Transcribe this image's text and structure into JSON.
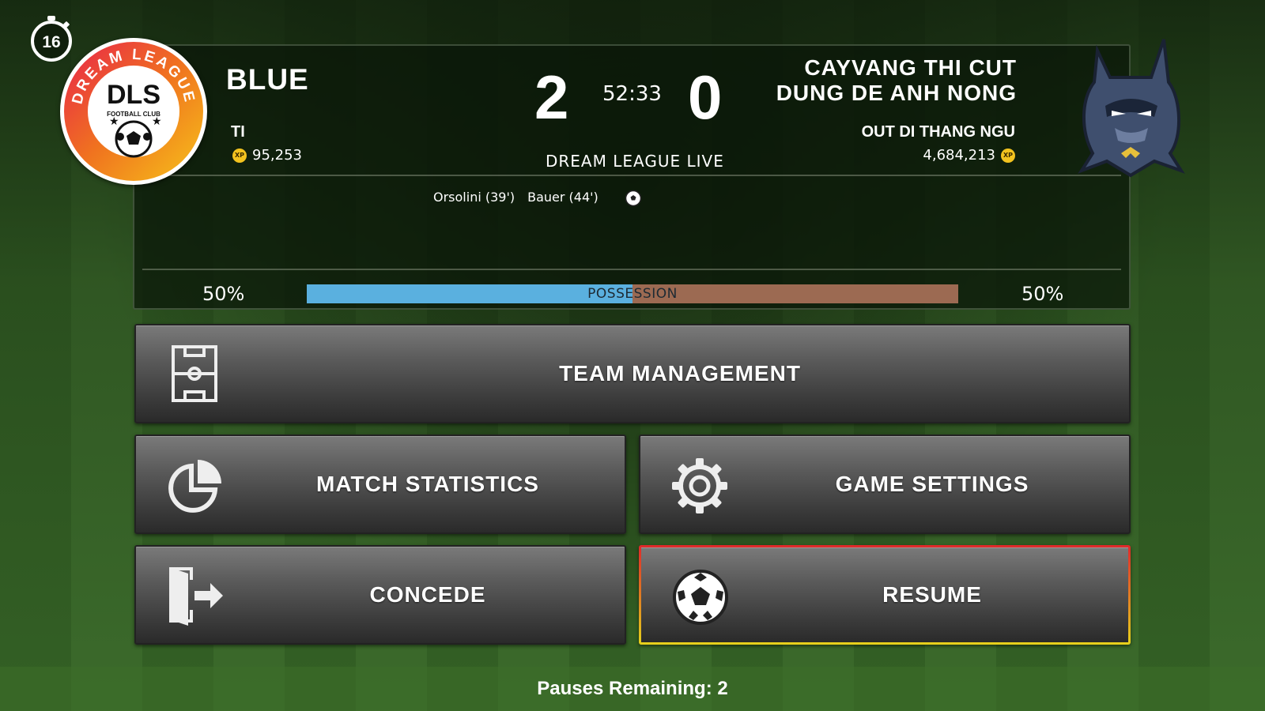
{
  "timer": {
    "value": "16"
  },
  "club_logo": {
    "text_ring": "DREAM LEAGUE",
    "center": "DLS",
    "sub": "FOOTBALL CLUB"
  },
  "home": {
    "name": "BLUE",
    "manager": "TI",
    "xp": "95,253",
    "score": "2",
    "possession": "50%"
  },
  "away": {
    "name_line1": "CAYVANG THI CUT",
    "name_line2": "DUNG DE ANH NONG",
    "manager": "OUT DI THANG NGU",
    "xp": "4,684,213",
    "score": "0",
    "possession": "50%"
  },
  "match": {
    "clock": "52:33",
    "league_label": "DREAM LEAGUE LIVE",
    "possession_label": "POSSESSION",
    "home_possession_fraction": 0.5
  },
  "scorers": [
    "Orsolini (39')",
    "Bauer (44')"
  ],
  "xp_badge": "XP",
  "menu": {
    "team_management": "TEAM MANAGEMENT",
    "match_statistics": "MATCH STATISTICS",
    "game_settings": "GAME SETTINGS",
    "concede": "CONCEDE",
    "resume": "RESUME"
  },
  "footer": {
    "pauses": "Pauses Remaining: 2"
  },
  "colors": {
    "home": "#5ab0df",
    "away": "#9c6a52",
    "resume_border_top": "#e0282a",
    "resume_border_bottom": "#e6d11c"
  }
}
